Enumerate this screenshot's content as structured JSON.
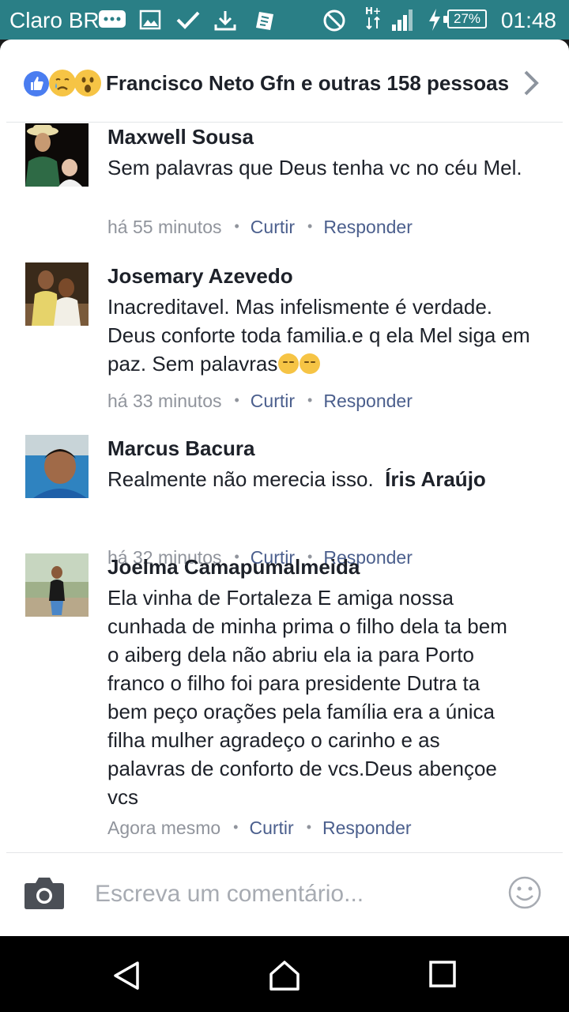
{
  "status_bar": {
    "carrier": "Claro BR",
    "battery": "27%",
    "time": "01:48"
  },
  "reactions": {
    "text": "Francisco Neto Gfn e outras 158 pessoas",
    "icons": [
      "like-icon",
      "sad-icon",
      "wow-icon"
    ]
  },
  "comments": [
    {
      "name": "Maxwell Sousa",
      "text": "Sem palavras que Deus tenha vc no céu Mel.",
      "time": "há 55 minutos",
      "like_label": "Curtir",
      "reply_label": "Responder"
    },
    {
      "name": "Josemary Azevedo",
      "text": "Inacreditavel. Mas infelismente é verdade. Deus conforte toda familia.e q ela Mel siga em paz. Sem palavras",
      "time": "há 33 minutos",
      "like_label": "Curtir",
      "reply_label": "Responder"
    },
    {
      "name": "Marcus Bacura",
      "text": "Realmente não merecia isso.",
      "mention": "Íris Araújo",
      "time": "há 32 minutos",
      "like_label": "Curtir",
      "reply_label": "Responder"
    },
    {
      "name": "Joelma Camapumalmeida",
      "text": "Ela vinha de Fortaleza  E amiga nossa cunhada de minha prima o filho dela ta bem o aiberg dela não abriu ela ia para Porto franco o filho foi para presidente Dutra ta bem peço orações pela família era a única filha mulher agradeço o carinho e as palavras de conforto de vcs.Deus abençoe vcs",
      "time": "Agora mesmo",
      "like_label": "Curtir",
      "reply_label": "Responder"
    }
  ],
  "composer": {
    "placeholder": "Escreva um comentário..."
  },
  "colors": {
    "status_bar": "#2a7f86",
    "link": "#4b5f8d",
    "muted": "#90949c",
    "text": "#1d2129"
  }
}
